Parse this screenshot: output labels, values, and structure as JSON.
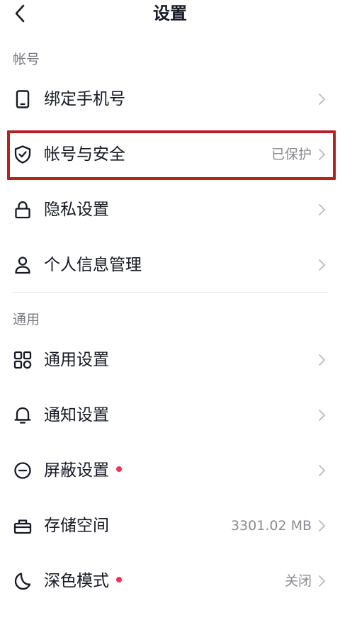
{
  "header": {
    "title": "设置",
    "back_icon": "chevron-left-icon"
  },
  "colors": {
    "highlight": "#b52025",
    "dot": "#fe2c55",
    "secondary_text": "#8a8b91"
  },
  "sections": [
    {
      "title": "帐号",
      "items": [
        {
          "icon": "phone-icon",
          "label": "绑定手机号",
          "value": ""
        },
        {
          "icon": "shield-check-icon",
          "label": "帐号与安全",
          "value": "已保护",
          "highlighted": true
        },
        {
          "icon": "lock-icon",
          "label": "隐私设置",
          "value": ""
        },
        {
          "icon": "person-icon",
          "label": "个人信息管理",
          "value": ""
        }
      ]
    },
    {
      "title": "通用",
      "items": [
        {
          "icon": "grid-icon",
          "label": "通用设置",
          "value": ""
        },
        {
          "icon": "bell-icon",
          "label": "通知设置",
          "value": ""
        },
        {
          "icon": "block-icon",
          "label": "屏蔽设置",
          "value": "",
          "dot": true
        },
        {
          "icon": "storage-icon",
          "label": "存储空间",
          "value": "3301.02 MB"
        },
        {
          "icon": "moon-icon",
          "label": "深色模式",
          "value": "关闭",
          "dot": true
        }
      ]
    }
  ]
}
